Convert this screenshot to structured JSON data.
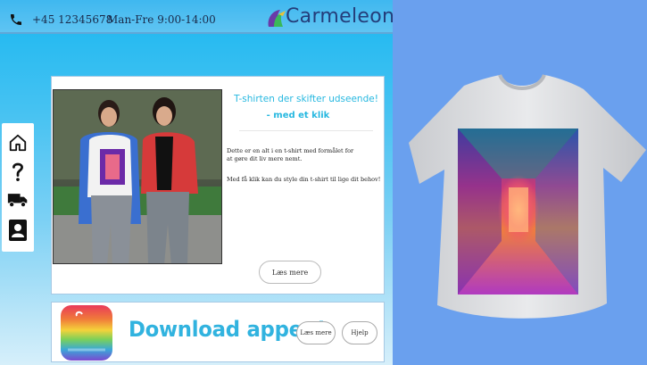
{
  "header": {
    "phone": "+45 12345678",
    "hours": "Man-Fre 9:00-14:00",
    "logo_text": "Carmeleon"
  },
  "sidenav": {
    "items": [
      {
        "icon": "home-icon"
      },
      {
        "icon": "help-icon"
      },
      {
        "icon": "truck-icon"
      },
      {
        "icon": "contact-icon"
      }
    ]
  },
  "hero": {
    "title": "T-shirten der skifter udseende!",
    "subtitle": "- med et klik",
    "paragraph1": "Dette er en alt i en t-shirt med formålet for at gøre dit liv mere nemt.",
    "paragraph2": "Med få klik kan du style din t-shirt til lige dit behov!",
    "more_label": "Læs mere"
  },
  "download": {
    "title": "Download appen!",
    "more_label": "Læs mere",
    "help_label": "Hjelp"
  },
  "colors": {
    "accent": "#31b3df",
    "site_bg_top": "#1ab7f0",
    "panel_bg": "#6aa0ee",
    "logo_text": "#243d7a"
  }
}
